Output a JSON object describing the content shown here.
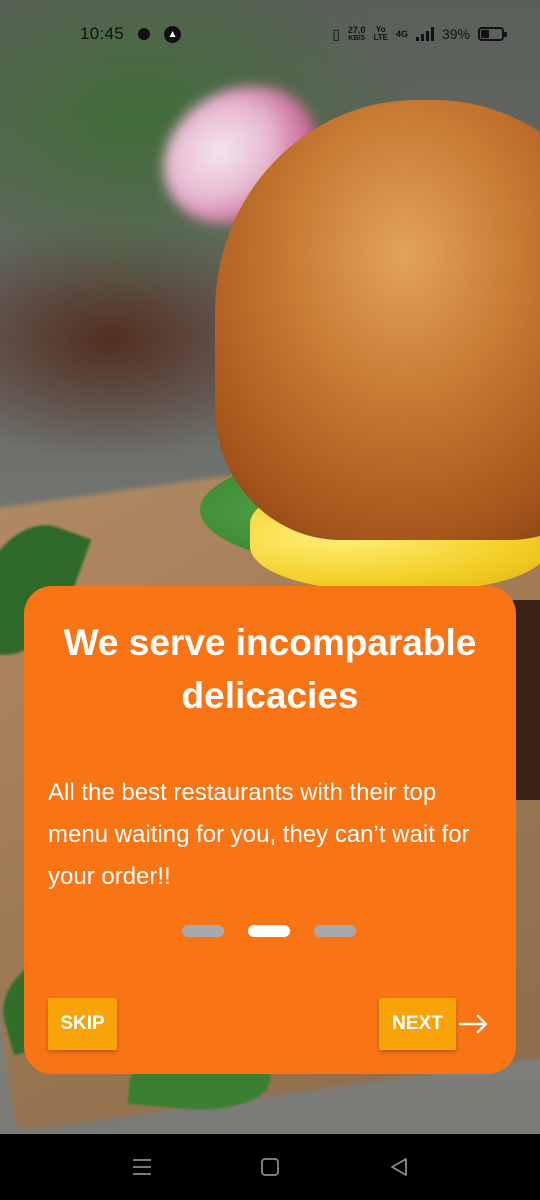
{
  "status_bar": {
    "time": "10:45",
    "net_speed_value": "27.0",
    "net_speed_unit": "KB/S",
    "volte_top": "Yo",
    "volte_bottom": "LTE",
    "network": "4G",
    "battery_percent": "39%",
    "battery_level": 0.39
  },
  "onboarding": {
    "title": "We serve incomparable delicacies",
    "description": "All the best restaurants with their top menu waiting for you, they can’t wait for your order!!",
    "pager": {
      "count": 3,
      "active_index": 1
    },
    "skip_label": "SKIP",
    "next_label": "NEXT"
  },
  "colors": {
    "card": "#f97415",
    "button": "#f8a409",
    "dot_inactive": "#a9a9ad",
    "dot_active": "#ffffff"
  },
  "icons": {
    "next_arrow": "arrow-right-icon",
    "nav_menu": "menu-icon",
    "nav_home": "home-icon",
    "nav_back": "back-icon"
  }
}
